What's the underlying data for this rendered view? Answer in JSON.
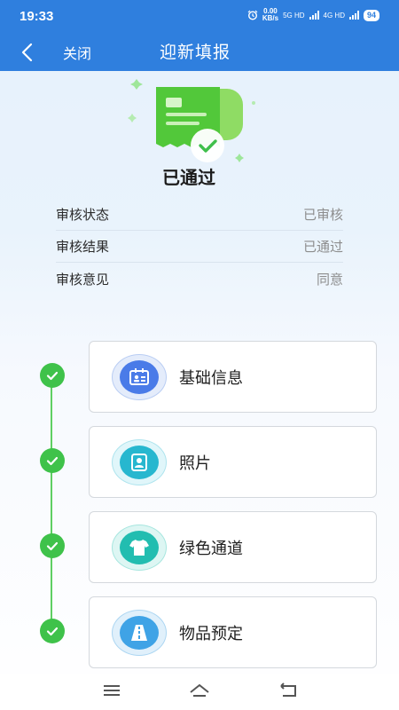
{
  "status_bar": {
    "time": "19:33",
    "net_speed_top": "0.00",
    "net_speed_bottom": "KB/s",
    "sim1": "5G HD",
    "sim2": "4G HD",
    "battery": "94"
  },
  "nav": {
    "close_label": "关闭",
    "title": "迎新填报"
  },
  "result": {
    "title": "已通过",
    "rows": [
      {
        "label": "审核状态",
        "value": "已审核"
      },
      {
        "label": "审核结果",
        "value": "已通过"
      },
      {
        "label": "审核意见",
        "value": "同意"
      }
    ]
  },
  "steps": [
    {
      "label": "基础信息",
      "icon": "id-card-icon",
      "color": "#4a7be8",
      "completed": true
    },
    {
      "label": "照片",
      "icon": "photo-portrait-icon",
      "color": "#27b7cf",
      "completed": true
    },
    {
      "label": "绿色通道",
      "icon": "tshirt-icon",
      "color": "#22bdb0",
      "completed": true
    },
    {
      "label": "物品预定",
      "icon": "road-icon",
      "color": "#3fa3e6",
      "completed": true
    }
  ],
  "colors": {
    "header": "#2f7fde",
    "check": "#3fc24a",
    "hero_green": "#52c83a"
  }
}
